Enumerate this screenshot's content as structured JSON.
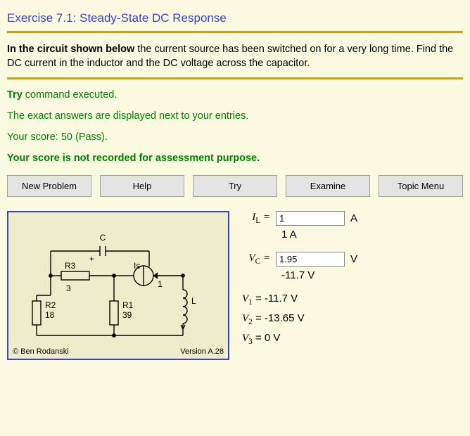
{
  "title": "Exercise 7.1: Steady-State DC Response",
  "problem": {
    "lead": "In the circuit shown below",
    "rest": " the current source has been switched on for a very long time. Find the DC current in the inductor and the DC voltage across the capacitor."
  },
  "feedback": {
    "line1_a": "Try",
    "line1_b": " command executed.",
    "line2": "The exact answers are displayed next to your entries.",
    "line3": "Your score: 50 (Pass).",
    "line4": "Your score is not recorded for assessment purpose."
  },
  "buttons": {
    "new_problem": "New Problem",
    "help": "Help",
    "try": "Try",
    "examine": "Examine",
    "topic_menu": "Topic Menu"
  },
  "circuit": {
    "labels": {
      "C": "C",
      "plus": "+",
      "R3": "R3",
      "R3_val": "3",
      "Is": "Is",
      "Is_val": "1",
      "R2": "R2",
      "R2_val": "18",
      "R1": "R1",
      "R1_val": "39",
      "L": "L"
    },
    "copyright": "© Ben Rodanski",
    "version": "Version A.28"
  },
  "answers": {
    "IL": {
      "sym_base": "I",
      "sym_sub": "L",
      "entered": "1",
      "unit": "A",
      "correct": "1 A"
    },
    "VC": {
      "sym_base": "V",
      "sym_sub": "C",
      "entered": "1.95",
      "unit": "V",
      "correct": "-11.7 V"
    },
    "V1": {
      "label_base": "V",
      "label_sub": "1",
      "value": " = -11.7 V"
    },
    "V2": {
      "label_base": "V",
      "label_sub": "2",
      "value": " = -13.65 V"
    },
    "V3": {
      "label_base": "V",
      "label_sub": "3",
      "value": " = 0 V"
    }
  }
}
